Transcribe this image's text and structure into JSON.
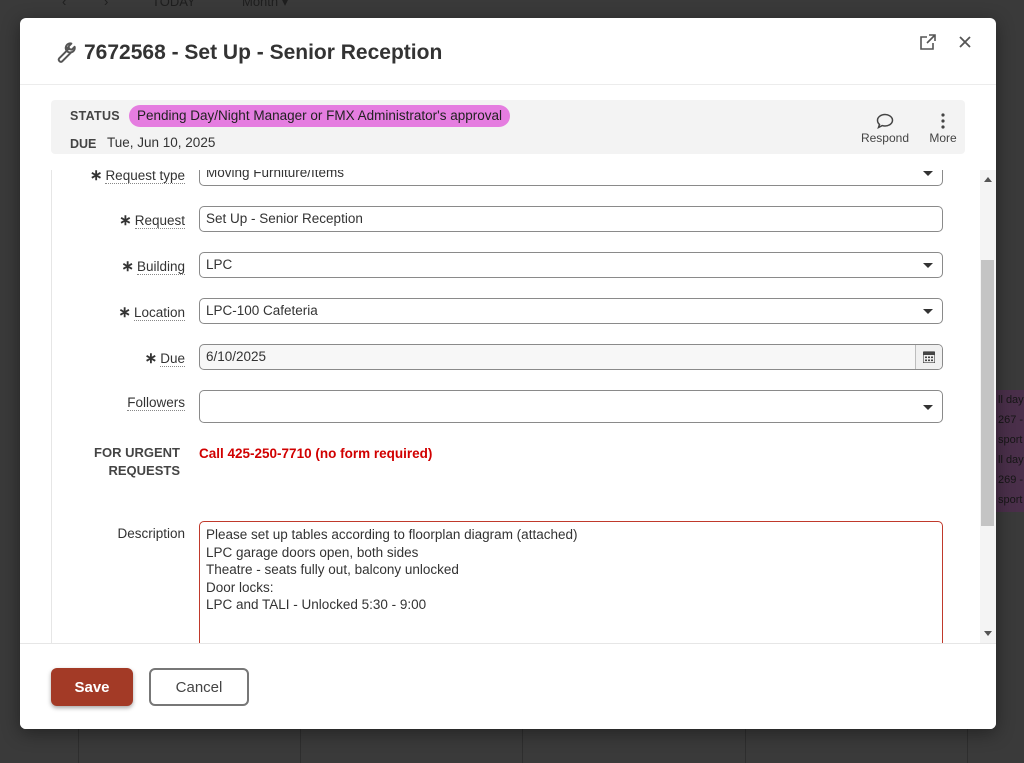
{
  "background": {
    "nav_today": "TODAY",
    "nav_view": "Month ▾",
    "event_lines": [
      "ll day",
      "267 -",
      "sport",
      "ll day",
      "269 -",
      "sport"
    ]
  },
  "modal": {
    "title": "7672568 - Set Up - Senior Reception",
    "icons": {
      "title": "wrench-icon",
      "popout": "external-link-icon",
      "close": "close-icon"
    }
  },
  "status": {
    "status_label": "STATUS",
    "status_value": "Pending Day/Night Manager or FMX Administrator's approval",
    "status_color": "#e57de0",
    "due_label": "DUE",
    "due_value": "Tue, Jun 10, 2025",
    "respond_label": "Respond",
    "more_label": "More"
  },
  "form": {
    "request_type": {
      "label": "Request type",
      "value": "Moving Furniture/Items"
    },
    "request": {
      "label": "Request",
      "value": "Set Up - Senior Reception"
    },
    "building": {
      "label": "Building",
      "value": "LPC"
    },
    "location": {
      "label": "Location",
      "value": "LPC-100 Cafeteria"
    },
    "due": {
      "label": "Due",
      "value": "6/10/2025"
    },
    "followers": {
      "label": "Followers",
      "value": ""
    },
    "urgent": {
      "label_line1": "FOR URGENT",
      "label_line2": "REQUESTS",
      "value": "Call 425-250-7710 (no form required)"
    },
    "description": {
      "label": "Description",
      "lines": [
        "Please set up tables according to floorplan diagram (attached)",
        "LPC garage doors open, both sides",
        "Theatre - seats fully out, balcony unlocked",
        "Door locks:",
        "LPC and TALI - Unlocked 5:30 - 9:00"
      ]
    },
    "required_marker": "∗"
  },
  "footer": {
    "save_label": "Save",
    "cancel_label": "Cancel",
    "save_color": "#a33a26"
  }
}
